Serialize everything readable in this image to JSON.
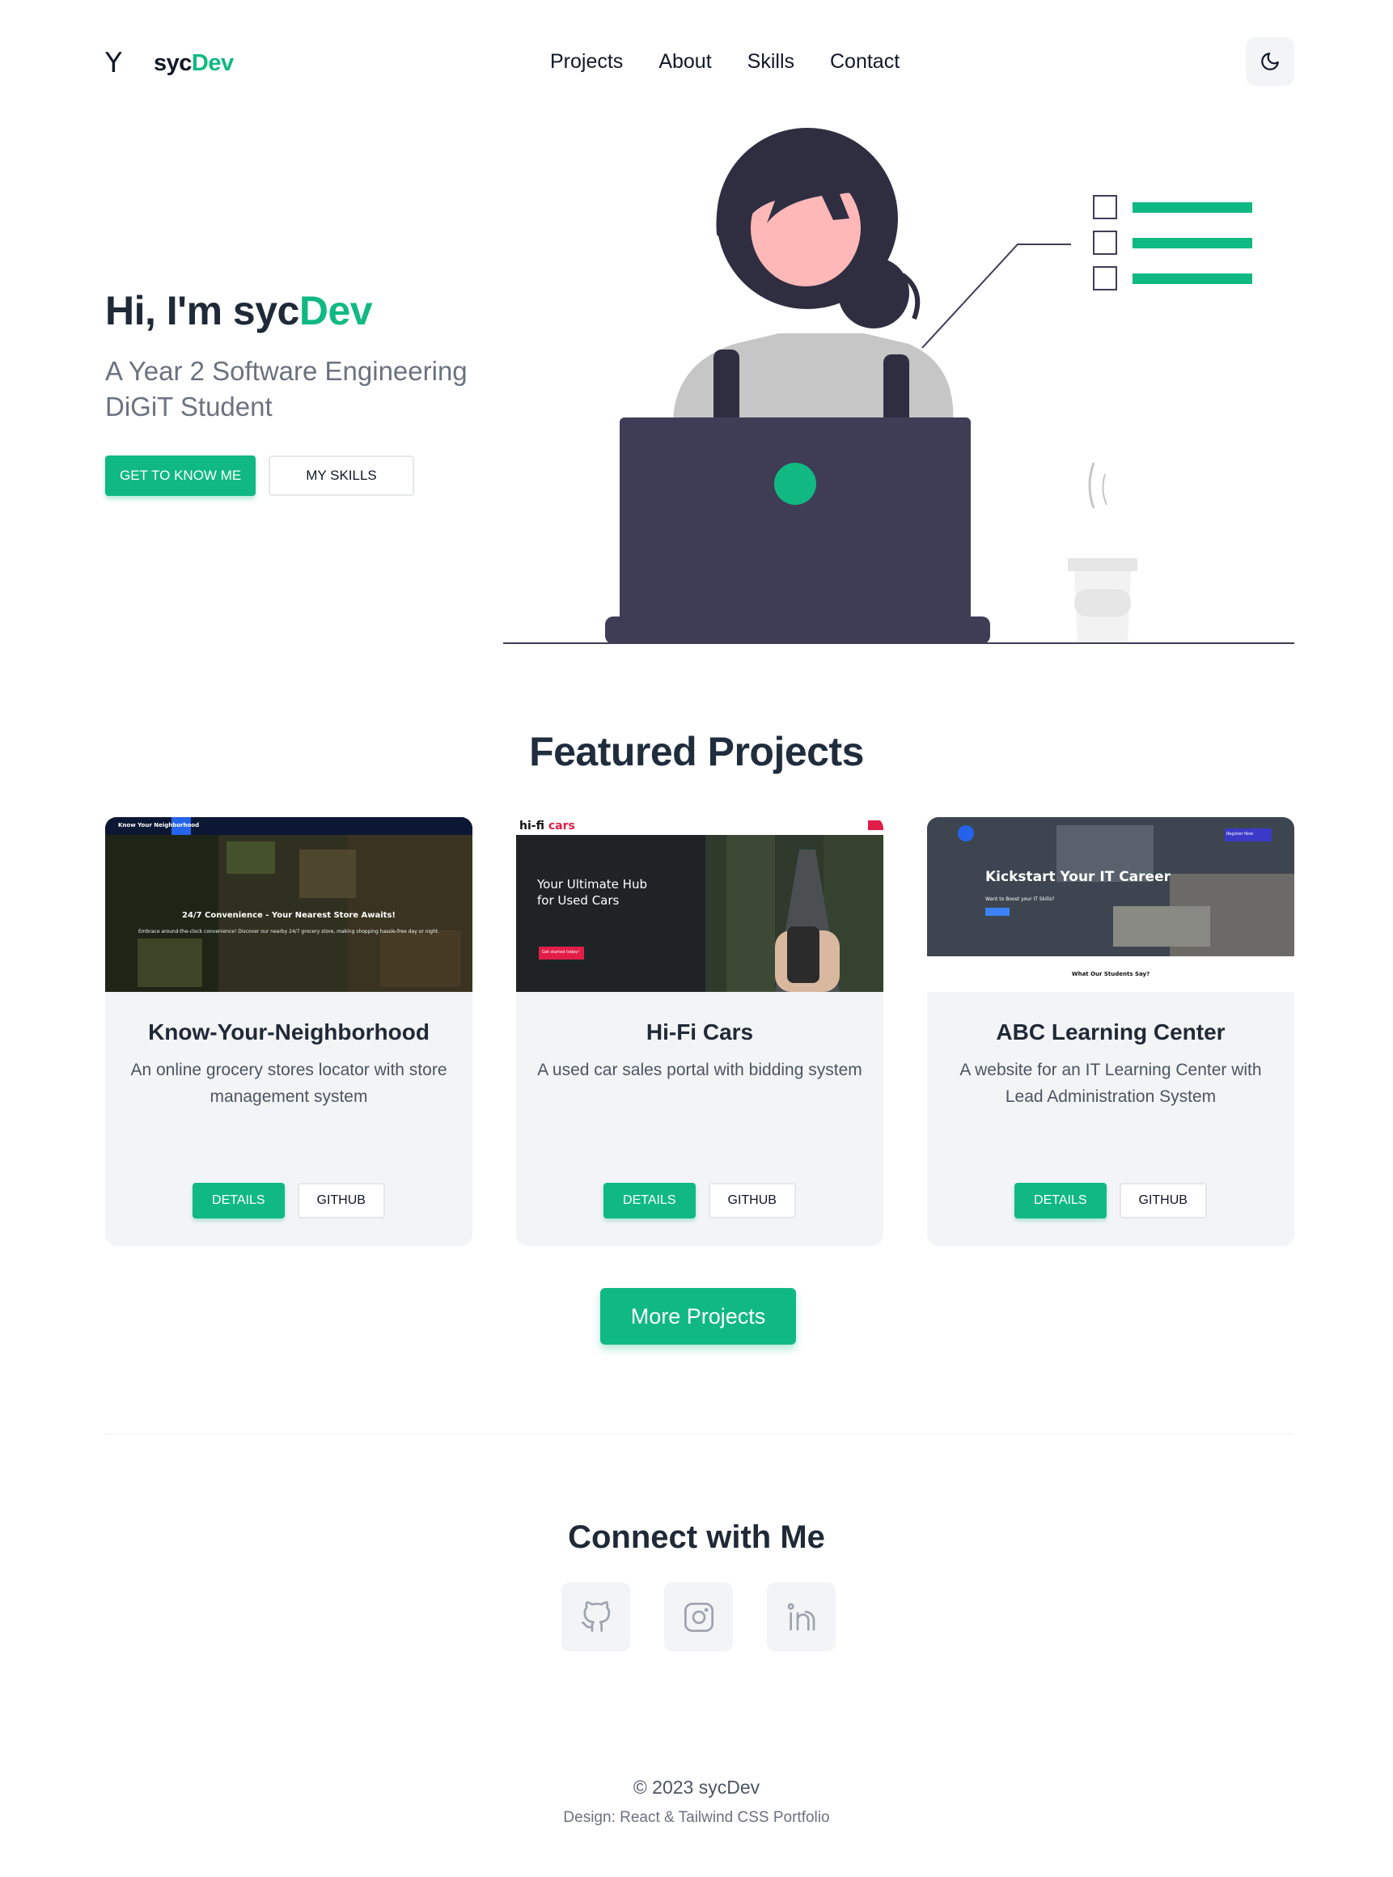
{
  "nav": {
    "logo_mark": "Y",
    "brand_prefix": "syc",
    "brand_accent": "Dev",
    "links": [
      "Projects",
      "About",
      "Skills",
      "Contact"
    ],
    "theme_icon": "moon-icon"
  },
  "hero": {
    "greeting": "Hi, I'm ",
    "name_prefix": "syc",
    "name_accent": "Dev",
    "subtitle_line1": "A Year 2 Software Engineering",
    "subtitle_line2": "DiGiT Student",
    "primary_button": "GET TO KNOW ME",
    "secondary_button": "MY SKILLS"
  },
  "featured": {
    "title": "Featured Projects",
    "projects": [
      {
        "title": "Know-Your-Neighborhood",
        "description": "An online grocery stores locator with store management system",
        "details_label": "DETAILS",
        "github_label": "GITHUB",
        "shot": {
          "nav_brand": "Know Your Neighborhood",
          "headline": "24/7 Convenience - Your Nearest Store Awaits!",
          "subline": "Embrace around-the-clock convenience! Discover our nearby 24/7 grocery store, making shopping hassle-free day or night."
        }
      },
      {
        "title": "Hi-Fi Cars",
        "description": "A used car sales portal with bidding system",
        "details_label": "DETAILS",
        "github_label": "GITHUB",
        "shot": {
          "brand_a": "hi-fi",
          "brand_b": "cars",
          "headline_1": "Your Ultimate Hub",
          "headline_2": "for Used Cars",
          "cta": "Get started today!"
        }
      },
      {
        "title": "ABC Learning Center",
        "description": "A website for an IT Learning Center with Lead Administration System",
        "details_label": "DETAILS",
        "github_label": "GITHUB",
        "shot": {
          "headline": "Kickstart Your IT Career",
          "subline": "Want to Boost your IT Skills?",
          "footer": "What Our Students Say?",
          "register": "Register Now"
        }
      }
    ],
    "more_button": "More Projects"
  },
  "connect": {
    "title": "Connect with Me",
    "icons": [
      "github-icon",
      "instagram-icon",
      "linkedin-icon"
    ]
  },
  "footer": {
    "copyright": "© 2023 sycDev",
    "credit": "Design: React & Tailwind CSS Portfolio"
  },
  "colors": {
    "accent": "#10b981",
    "heading": "#1f2937",
    "laptop": "#3f3d56",
    "hair": "#2f2e41",
    "skin": "#ffb8b8"
  }
}
